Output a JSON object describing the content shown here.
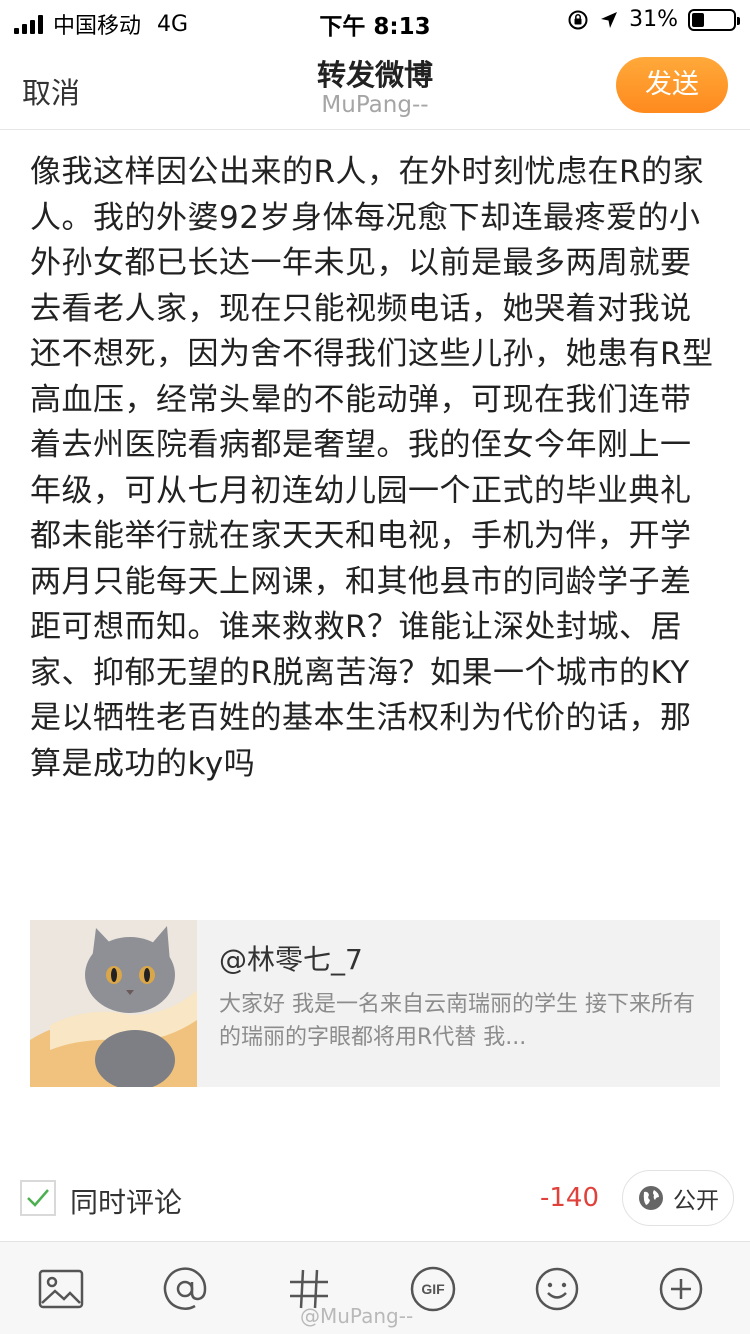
{
  "status_bar": {
    "carrier": "中国移动",
    "network": "4G",
    "time": "下午 8:13",
    "battery_percent": "31%",
    "battery_level": 0.31
  },
  "nav": {
    "cancel_label": "取消",
    "title": "转发微博",
    "subtitle": "MuPang--",
    "send_label": "发送"
  },
  "post": {
    "text": "像我这样因公出来的R人，在外时刻忧虑在R的家人。我的外婆92岁身体每况愈下却连最疼爱的小外孙女都已长达一年未见，以前是最多两周就要去看老人家，现在只能视频电话，她哭着对我说还不想死，因为舍不得我们这些儿孙，她患有R型高血压，经常头晕的不能动弹，可现在我们连带着去州医院看病都是奢望。我的侄女今年刚上一年级，可从七月初连幼儿园一个正式的毕业典礼都未能举行就在家天天和电视，手机为伴，开学两月只能每天上网课，和其他县市的同龄学子差距可想而知。谁来救救R？谁能让深处封城、居家、抑郁无望的R脱离苦海？如果一个城市的KY是以牺牲老百姓的基本生活权利为代价的话，那算是成功的ky吗"
  },
  "quote": {
    "author": "@林零七_7",
    "snippet": "大家好 我是一名来自云南瑞丽的学生 接下来所有的瑞丽的字眼都将用R代替 我..."
  },
  "comment": {
    "label": "同时评论",
    "char_count": "-140",
    "visibility_label": "公开",
    "checked": true
  },
  "toolbar": {
    "gif_label": "GIF",
    "watermark": "@MuPang--"
  },
  "colors": {
    "accent_orange": "#ff9a2e",
    "count_red": "#e0413a",
    "check_green": "#4caf50"
  }
}
